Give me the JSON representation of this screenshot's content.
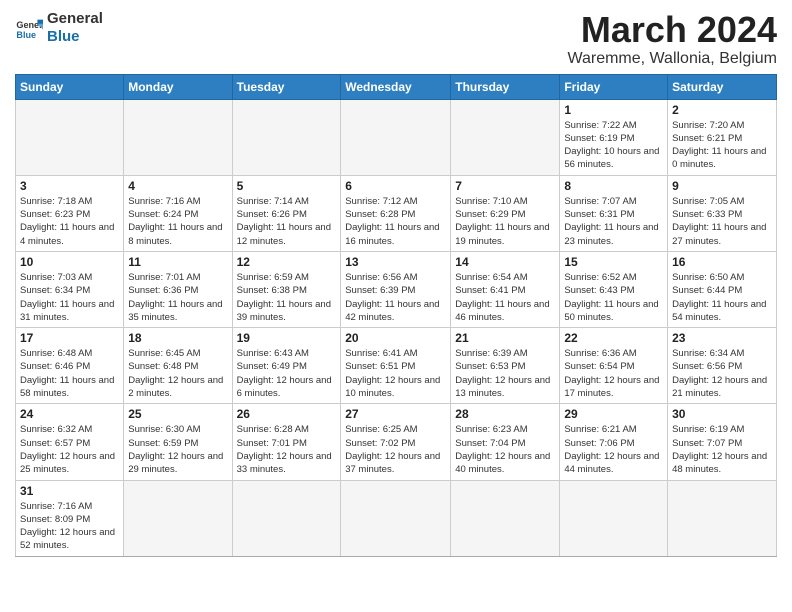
{
  "logo": {
    "text_general": "General",
    "text_blue": "Blue"
  },
  "title": {
    "month_year": "March 2024",
    "location": "Waremme, Wallonia, Belgium"
  },
  "weekdays": [
    "Sunday",
    "Monday",
    "Tuesday",
    "Wednesday",
    "Thursday",
    "Friday",
    "Saturday"
  ],
  "weeks": [
    [
      {
        "day": "",
        "info": ""
      },
      {
        "day": "",
        "info": ""
      },
      {
        "day": "",
        "info": ""
      },
      {
        "day": "",
        "info": ""
      },
      {
        "day": "",
        "info": ""
      },
      {
        "day": "1",
        "info": "Sunrise: 7:22 AM\nSunset: 6:19 PM\nDaylight: 10 hours and 56 minutes."
      },
      {
        "day": "2",
        "info": "Sunrise: 7:20 AM\nSunset: 6:21 PM\nDaylight: 11 hours and 0 minutes."
      }
    ],
    [
      {
        "day": "3",
        "info": "Sunrise: 7:18 AM\nSunset: 6:23 PM\nDaylight: 11 hours and 4 minutes."
      },
      {
        "day": "4",
        "info": "Sunrise: 7:16 AM\nSunset: 6:24 PM\nDaylight: 11 hours and 8 minutes."
      },
      {
        "day": "5",
        "info": "Sunrise: 7:14 AM\nSunset: 6:26 PM\nDaylight: 11 hours and 12 minutes."
      },
      {
        "day": "6",
        "info": "Sunrise: 7:12 AM\nSunset: 6:28 PM\nDaylight: 11 hours and 16 minutes."
      },
      {
        "day": "7",
        "info": "Sunrise: 7:10 AM\nSunset: 6:29 PM\nDaylight: 11 hours and 19 minutes."
      },
      {
        "day": "8",
        "info": "Sunrise: 7:07 AM\nSunset: 6:31 PM\nDaylight: 11 hours and 23 minutes."
      },
      {
        "day": "9",
        "info": "Sunrise: 7:05 AM\nSunset: 6:33 PM\nDaylight: 11 hours and 27 minutes."
      }
    ],
    [
      {
        "day": "10",
        "info": "Sunrise: 7:03 AM\nSunset: 6:34 PM\nDaylight: 11 hours and 31 minutes."
      },
      {
        "day": "11",
        "info": "Sunrise: 7:01 AM\nSunset: 6:36 PM\nDaylight: 11 hours and 35 minutes."
      },
      {
        "day": "12",
        "info": "Sunrise: 6:59 AM\nSunset: 6:38 PM\nDaylight: 11 hours and 39 minutes."
      },
      {
        "day": "13",
        "info": "Sunrise: 6:56 AM\nSunset: 6:39 PM\nDaylight: 11 hours and 42 minutes."
      },
      {
        "day": "14",
        "info": "Sunrise: 6:54 AM\nSunset: 6:41 PM\nDaylight: 11 hours and 46 minutes."
      },
      {
        "day": "15",
        "info": "Sunrise: 6:52 AM\nSunset: 6:43 PM\nDaylight: 11 hours and 50 minutes."
      },
      {
        "day": "16",
        "info": "Sunrise: 6:50 AM\nSunset: 6:44 PM\nDaylight: 11 hours and 54 minutes."
      }
    ],
    [
      {
        "day": "17",
        "info": "Sunrise: 6:48 AM\nSunset: 6:46 PM\nDaylight: 11 hours and 58 minutes."
      },
      {
        "day": "18",
        "info": "Sunrise: 6:45 AM\nSunset: 6:48 PM\nDaylight: 12 hours and 2 minutes."
      },
      {
        "day": "19",
        "info": "Sunrise: 6:43 AM\nSunset: 6:49 PM\nDaylight: 12 hours and 6 minutes."
      },
      {
        "day": "20",
        "info": "Sunrise: 6:41 AM\nSunset: 6:51 PM\nDaylight: 12 hours and 10 minutes."
      },
      {
        "day": "21",
        "info": "Sunrise: 6:39 AM\nSunset: 6:53 PM\nDaylight: 12 hours and 13 minutes."
      },
      {
        "day": "22",
        "info": "Sunrise: 6:36 AM\nSunset: 6:54 PM\nDaylight: 12 hours and 17 minutes."
      },
      {
        "day": "23",
        "info": "Sunrise: 6:34 AM\nSunset: 6:56 PM\nDaylight: 12 hours and 21 minutes."
      }
    ],
    [
      {
        "day": "24",
        "info": "Sunrise: 6:32 AM\nSunset: 6:57 PM\nDaylight: 12 hours and 25 minutes."
      },
      {
        "day": "25",
        "info": "Sunrise: 6:30 AM\nSunset: 6:59 PM\nDaylight: 12 hours and 29 minutes."
      },
      {
        "day": "26",
        "info": "Sunrise: 6:28 AM\nSunset: 7:01 PM\nDaylight: 12 hours and 33 minutes."
      },
      {
        "day": "27",
        "info": "Sunrise: 6:25 AM\nSunset: 7:02 PM\nDaylight: 12 hours and 37 minutes."
      },
      {
        "day": "28",
        "info": "Sunrise: 6:23 AM\nSunset: 7:04 PM\nDaylight: 12 hours and 40 minutes."
      },
      {
        "day": "29",
        "info": "Sunrise: 6:21 AM\nSunset: 7:06 PM\nDaylight: 12 hours and 44 minutes."
      },
      {
        "day": "30",
        "info": "Sunrise: 6:19 AM\nSunset: 7:07 PM\nDaylight: 12 hours and 48 minutes."
      }
    ],
    [
      {
        "day": "31",
        "info": "Sunrise: 7:16 AM\nSunset: 8:09 PM\nDaylight: 12 hours and 52 minutes."
      },
      {
        "day": "",
        "info": ""
      },
      {
        "day": "",
        "info": ""
      },
      {
        "day": "",
        "info": ""
      },
      {
        "day": "",
        "info": ""
      },
      {
        "day": "",
        "info": ""
      },
      {
        "day": "",
        "info": ""
      }
    ]
  ]
}
